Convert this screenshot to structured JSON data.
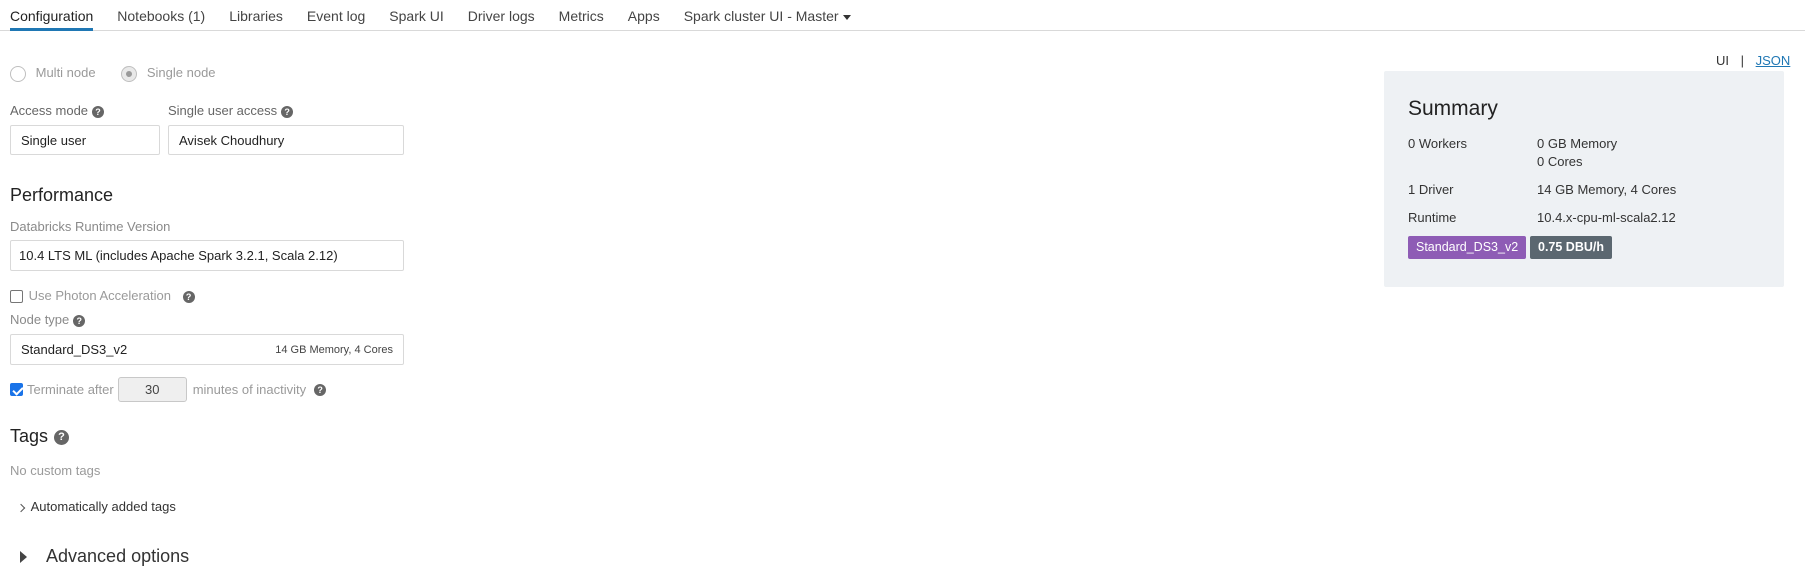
{
  "tabs": [
    {
      "label": "Configuration",
      "active": true
    },
    {
      "label": "Notebooks (1)"
    },
    {
      "label": "Libraries"
    },
    {
      "label": "Event log"
    },
    {
      "label": "Spark UI"
    },
    {
      "label": "Driver logs"
    },
    {
      "label": "Metrics"
    },
    {
      "label": "Apps"
    },
    {
      "label": "Spark cluster UI - Master"
    }
  ],
  "view_toggle": {
    "ui": "UI",
    "sep": "|",
    "json": "JSON"
  },
  "node_mode": {
    "multi": "Multi node",
    "single": "Single node",
    "selected": "single"
  },
  "access_mode": {
    "label": "Access mode",
    "value": "Single user"
  },
  "single_user_access": {
    "label": "Single user access",
    "value": "Avisek Choudhury"
  },
  "performance": {
    "title": "Performance",
    "runtime_label": "Databricks Runtime Version",
    "runtime_value": "10.4 LTS ML (includes Apache Spark 3.2.1, Scala 2.12)",
    "photon_label": "Use Photon Acceleration",
    "photon_checked": false,
    "node_type_label": "Node type",
    "node_type_value": "Standard_DS3_v2",
    "node_type_detail": "14 GB Memory, 4 Cores",
    "terminate_prefix": "Terminate after",
    "terminate_minutes": "30",
    "terminate_suffix": "minutes of inactivity",
    "terminate_checked": true
  },
  "tags": {
    "title": "Tags",
    "empty": "No custom tags",
    "auto_label": "Automatically added tags"
  },
  "advanced": {
    "label": "Advanced options"
  },
  "summary": {
    "title": "Summary",
    "workers_label": "0 Workers",
    "workers_memory": "0 GB Memory",
    "workers_cores": "0 Cores",
    "driver_label": "1 Driver",
    "driver_value": "14 GB Memory, 4 Cores",
    "runtime_label": "Runtime",
    "runtime_value": "10.4.x-cpu-ml-scala2.12",
    "badge_node": "Standard_DS3_v2",
    "badge_dbu": "0.75 DBU/h",
    "colors": {
      "node_badge": "#8e5cb5",
      "dbu_badge": "#5b6770"
    }
  }
}
